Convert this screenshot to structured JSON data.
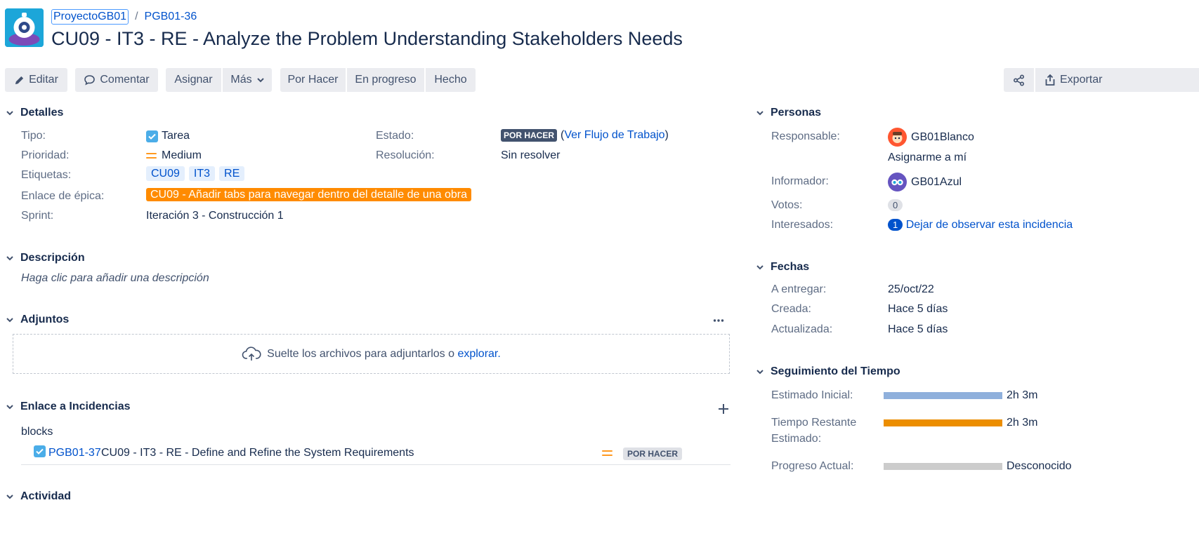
{
  "breadcrumb": {
    "project": "ProyectoGB01",
    "separator": "/",
    "issue_key": "PGB01-36"
  },
  "issue": {
    "title": "CU09 - IT3 - RE - Analyze the Problem Understanding Stakeholders Needs"
  },
  "toolbar": {
    "edit": "Editar",
    "comment": "Comentar",
    "assign": "Asignar",
    "more": "Más",
    "todo": "Por Hacer",
    "in_progress": "En progreso",
    "done": "Hecho",
    "export": "Exportar"
  },
  "details": {
    "header": "Detalles",
    "type_label": "Tipo:",
    "type_value": "Tarea",
    "priority_label": "Prioridad:",
    "priority_value": "Medium",
    "labels_label": "Etiquetas:",
    "labels": [
      "CU09",
      "IT3",
      "RE"
    ],
    "epic_label": "Enlace de épica:",
    "epic_value": "CU09 - Añadir tabs para navegar dentro del detalle de una obra",
    "sprint_label": "Sprint:",
    "sprint_value": "Iteración 3 - Construcción 1",
    "status_label": "Estado:",
    "status_value": "POR HACER",
    "workflow_link": "Ver Flujo de Trabajo",
    "paren_open": "(",
    "paren_close": ")",
    "resolution_label": "Resolución:",
    "resolution_value": "Sin resolver"
  },
  "description": {
    "header": "Descripción",
    "placeholder": "Haga clic para añadir una descripción"
  },
  "attachments": {
    "header": "Adjuntos",
    "drop_text": "Suelte los archivos para adjuntarlos o",
    "browse_link": "explorar."
  },
  "links": {
    "header": "Enlace a Incidencias",
    "relation": "blocks",
    "items": [
      {
        "key": "PGB01-37",
        "summary": "CU09 - IT3 - RE - Define and Refine the System Requirements",
        "status": "POR HACER"
      }
    ]
  },
  "activity": {
    "header": "Actividad"
  },
  "people": {
    "header": "Personas",
    "assignee_label": "Responsable:",
    "assignee": "GB01Blanco",
    "assign_me": "Asignarme a mí",
    "reporter_label": "Informador:",
    "reporter": "GB01Azul",
    "votes_label": "Votos:",
    "votes": "0",
    "watchers_label": "Interesados:",
    "watchers": "1",
    "watch_link": "Dejar de observar esta incidencia"
  },
  "dates": {
    "header": "Fechas",
    "due_label": "A entregar:",
    "due": "25/oct/22",
    "created_label": "Creada:",
    "created": "Hace 5 días",
    "updated_label": "Actualizada:",
    "updated": "Hace 5 días"
  },
  "time_tracking": {
    "header": "Seguimiento del Tiempo",
    "original_label": "Estimado Inicial:",
    "original_value": "2h 3m",
    "remaining_label_1": "Tiempo Restante",
    "remaining_label_2": "Estimado:",
    "remaining_value": "2h 3m",
    "logged_label": "Progreso Actual:",
    "logged_value": "Desconocido",
    "original_fill": 1.0,
    "remaining_fill": 1.0,
    "logged_fill": 0.0
  },
  "colors": {
    "link": "#0052cc",
    "epic": "#ff8b00",
    "estimate_bar": "#8fb0dc",
    "remaining_bar": "#ec8e00",
    "logged_bar": "#cccccc"
  }
}
